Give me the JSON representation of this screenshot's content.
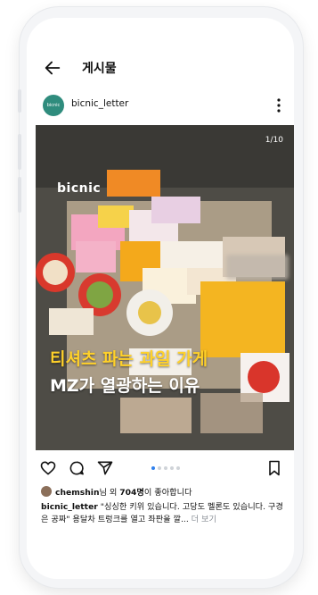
{
  "header": {
    "title": "게시물"
  },
  "profile": {
    "avatar_text": "bicnic",
    "username": "bicnic_letter"
  },
  "post": {
    "counter": "1/10",
    "brand": "bicnic",
    "headline_line1": "티셔츠 파는 과일 가게",
    "headline_line2": "MZ가 열광하는 이유"
  },
  "carousel": {
    "total_dots": 5,
    "active_index": 0
  },
  "likes": {
    "user": "chemshin",
    "suffix1": "님 외 ",
    "count": "704명",
    "suffix2": "이 좋아합니다"
  },
  "caption": {
    "username": "bicnic_letter",
    "text": " \"싱싱한 키위 있습니다. 고당도 멜론도 있습니다. 구경은 공짜\" 용달차 트렁크를 열고 좌판을 깔...",
    "more": " 더 보기"
  },
  "icons": {
    "back": "back-arrow-icon",
    "more": "more-vertical-icon",
    "like": "heart-icon",
    "comment": "comment-icon",
    "share": "send-icon",
    "save": "bookmark-icon"
  },
  "colors": {
    "headline_yellow": "#ffd12a",
    "avatar": "#2f8c7d",
    "active_dot": "#2f80ed"
  }
}
